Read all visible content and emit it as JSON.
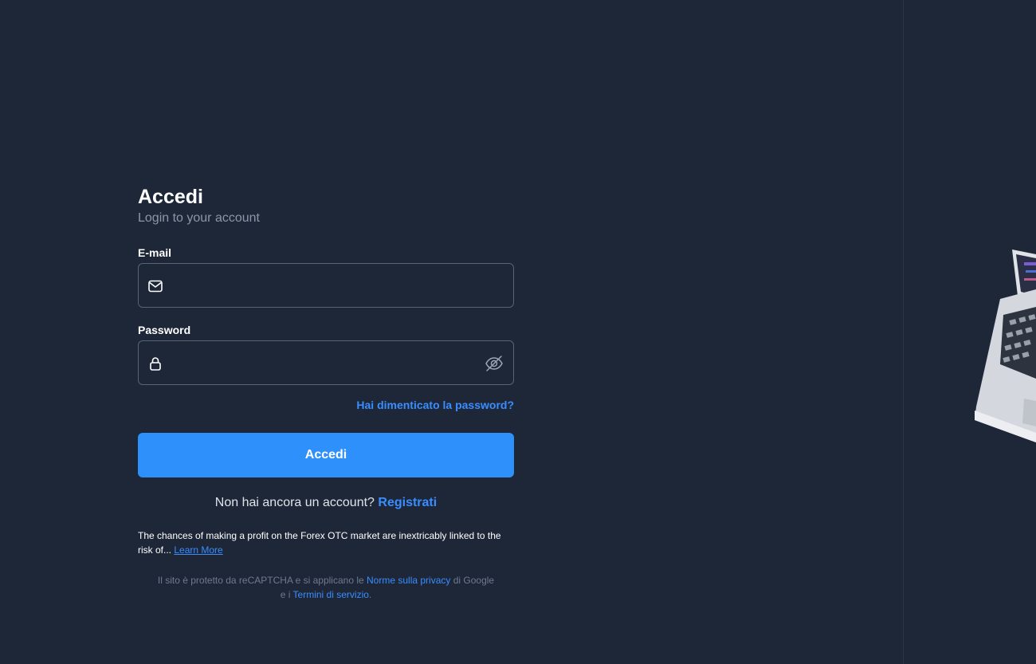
{
  "login": {
    "title": "Accedi",
    "subtitle": "Login to your account",
    "email_label": "E-mail",
    "email_value": "",
    "password_label": "Password",
    "password_value": "",
    "forgot_link": "Hai dimenticato la password?",
    "submit_label": "Accedi",
    "signup_prompt": "Non hai ancora un account?",
    "signup_link": "Registrati"
  },
  "disclaimer": {
    "risk_text": "The chances of making a profit on the Forex OTC market are inextricably linked to the risk of...",
    "learn_more": "Learn More",
    "recaptcha_pre": "Il sito è protetto da reCAPTCHA e si applicano le",
    "privacy_link": "Norme sulla privacy",
    "recaptcha_mid": "di Google",
    "recaptcha_and": "e i",
    "terms_link": "Termini di servizio",
    "recaptcha_end": "."
  },
  "icons": {
    "email": "mail-icon",
    "password": "lock-icon",
    "toggle_visibility": "eye-off-icon"
  },
  "colors": {
    "background": "#1e2738",
    "accent": "#2e90fa",
    "link": "#3a8dff",
    "muted_text": "#8d96a8",
    "field_border": "#5a6375"
  }
}
